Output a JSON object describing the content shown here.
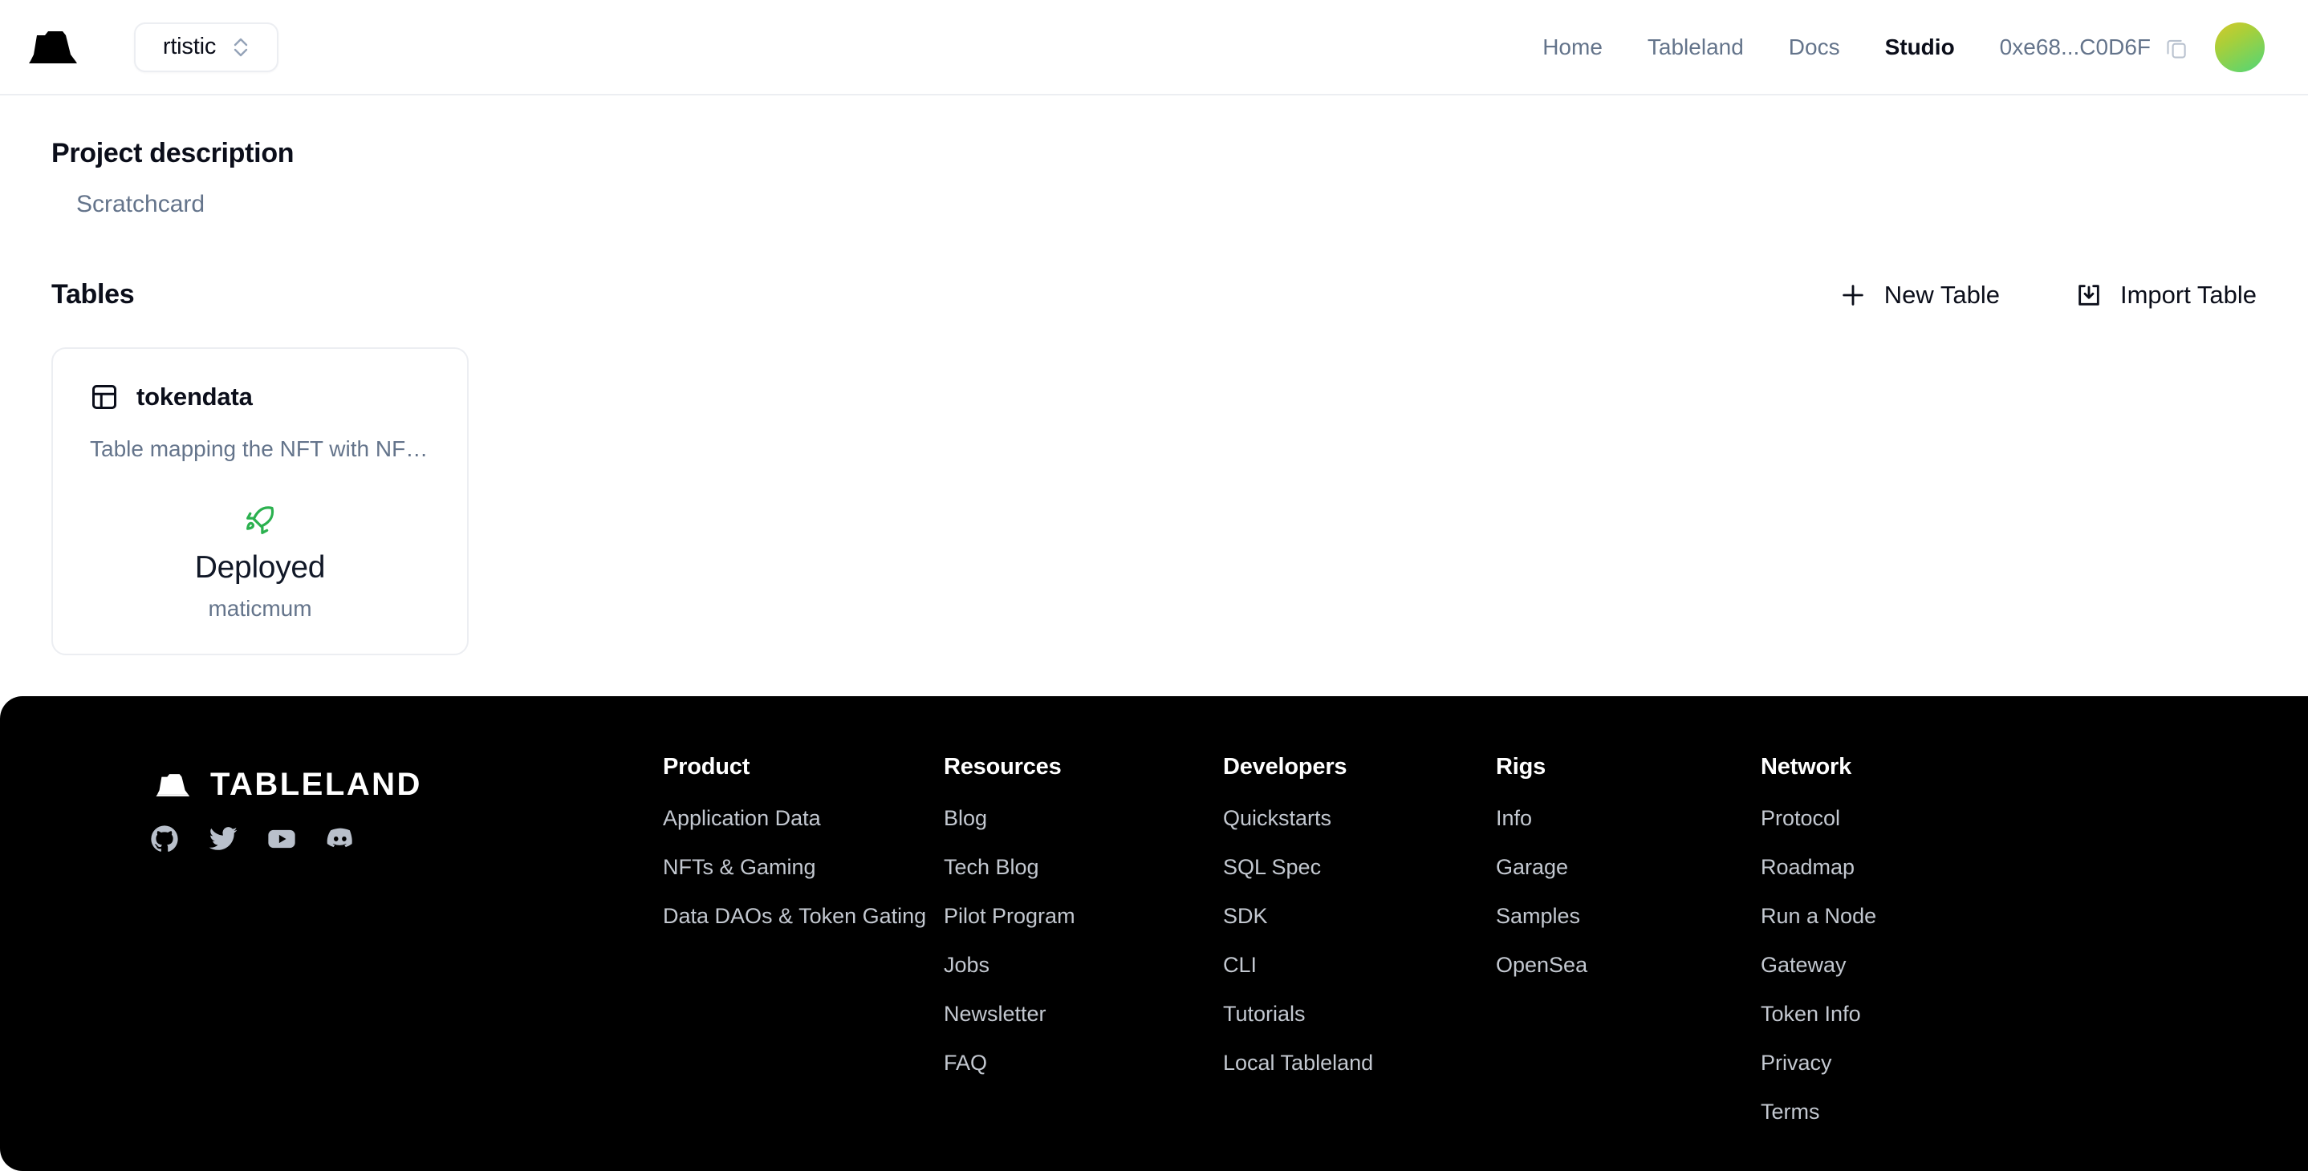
{
  "header": {
    "logo_name": "tableland-logo",
    "project_selector": {
      "value": "rtistic",
      "icon": "chevron-up-down-icon"
    },
    "nav_links": [
      {
        "label": "Home",
        "active": false
      },
      {
        "label": "Tableland",
        "active": false
      },
      {
        "label": "Docs",
        "active": false
      },
      {
        "label": "Studio",
        "active": true
      }
    ],
    "wallet_address": "0xe68...C0D6F",
    "copy_icon": "copy-icon",
    "avatar": {
      "icon": "avatar",
      "gradient_from": "#d6c82a",
      "gradient_to": "#4fd678"
    }
  },
  "main": {
    "project_description_title": "Project description",
    "project_description_text": "Scratchcard",
    "tables_title": "Tables",
    "actions": [
      {
        "label": "New Table",
        "icon": "plus-icon"
      },
      {
        "label": "Import Table",
        "icon": "import-download-icon"
      }
    ],
    "tables": [
      {
        "icon": "table-grid-icon",
        "name": "tokendata",
        "description": "Table mapping the NFT with NFT …",
        "status_icon": "rocket-icon",
        "status": "Deployed",
        "network": "maticmum",
        "status_color": "#2bb14f"
      }
    ]
  },
  "footer": {
    "wordmark": "TABLELAND",
    "socials": [
      {
        "name": "github-icon"
      },
      {
        "name": "twitter-icon"
      },
      {
        "name": "youtube-icon"
      },
      {
        "name": "discord-icon"
      }
    ],
    "columns": [
      {
        "title": "Product",
        "links": [
          "Application Data",
          "NFTs & Gaming",
          "Data DAOs & Token Gating"
        ]
      },
      {
        "title": "Resources",
        "links": [
          "Blog",
          "Tech Blog",
          "Pilot Program",
          "Jobs",
          "Newsletter",
          "FAQ"
        ]
      },
      {
        "title": "Developers",
        "links": [
          "Quickstarts",
          "SQL Spec",
          "SDK",
          "CLI",
          "Tutorials",
          "Local Tableland"
        ]
      },
      {
        "title": "Rigs",
        "links": [
          "Info",
          "Garage",
          "Samples",
          "OpenSea"
        ]
      },
      {
        "title": "Network",
        "links": [
          "Protocol",
          "Roadmap",
          "Run a Node",
          "Gateway",
          "Token Info",
          "Privacy",
          "Terms"
        ]
      }
    ]
  }
}
